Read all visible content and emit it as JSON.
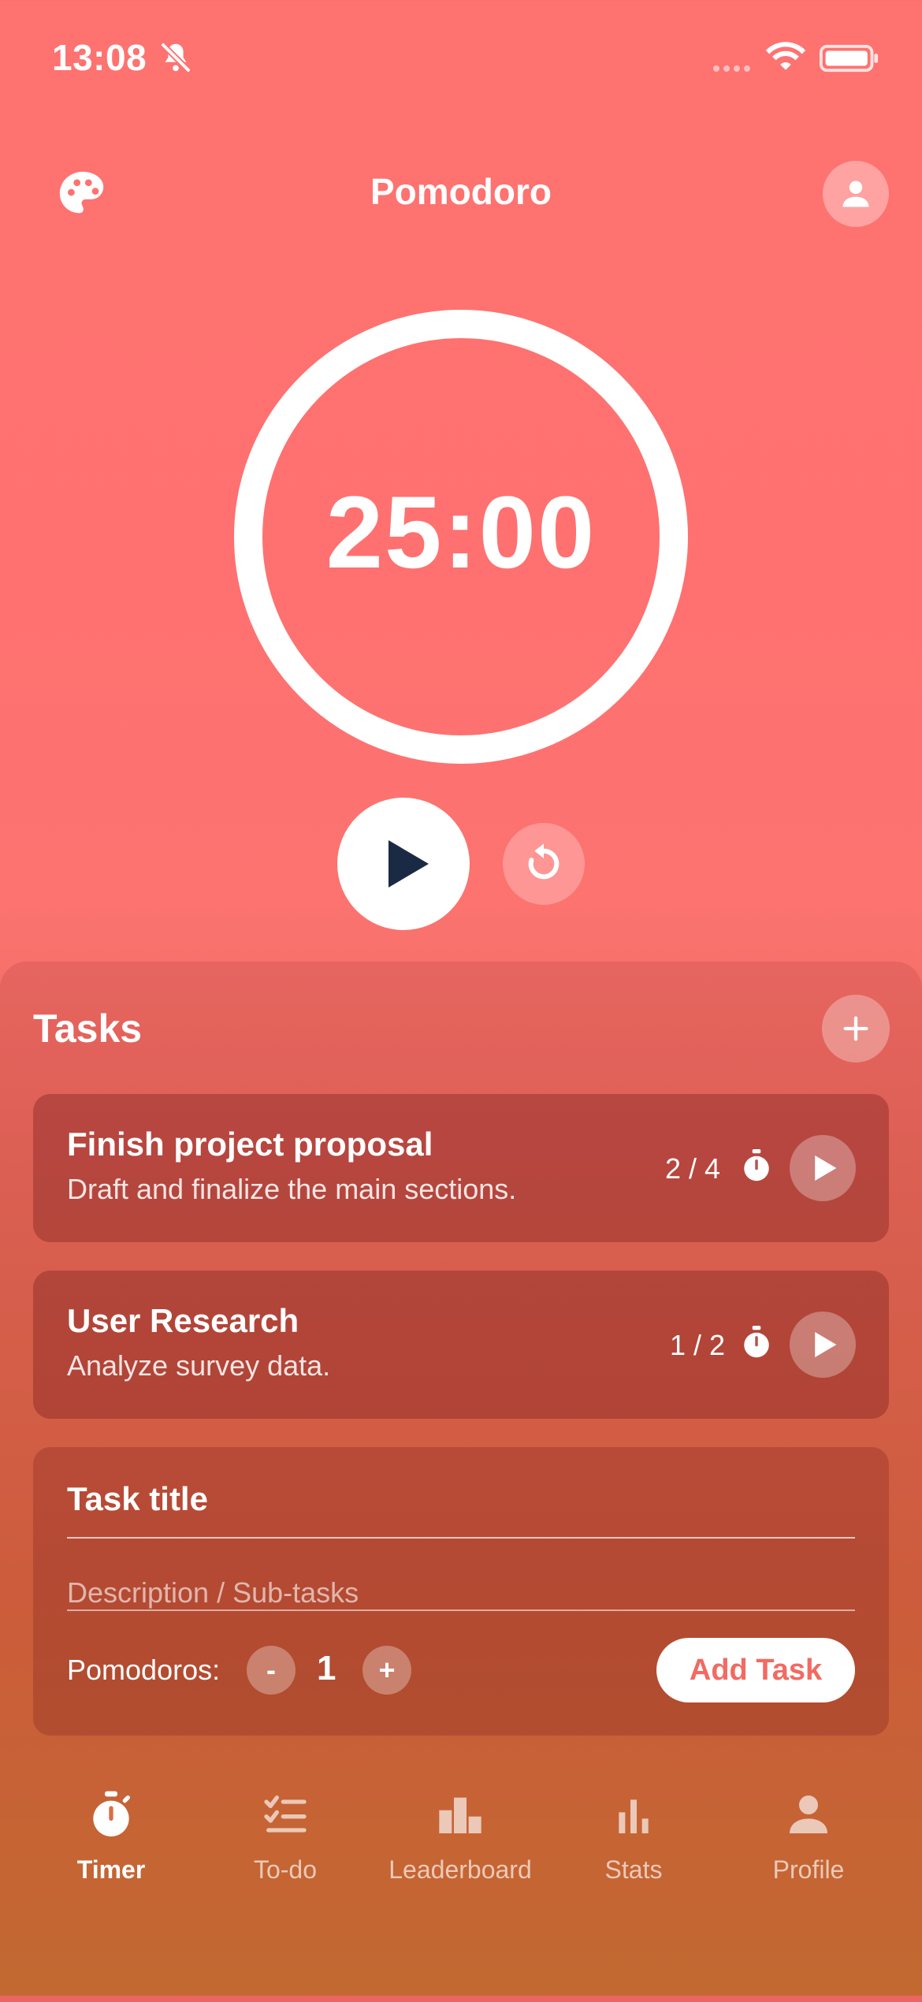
{
  "status": {
    "time": "13:08"
  },
  "header": {
    "title": "Pomodoro"
  },
  "timer": {
    "display": "25:00"
  },
  "tasks": {
    "heading": "Tasks",
    "items": [
      {
        "title": "Finish project proposal",
        "description": "Draft and finalize the main sections.",
        "count": "2 / 4"
      },
      {
        "title": "User Research",
        "description": "Analyze survey data.",
        "count": "1 / 2"
      }
    ]
  },
  "form": {
    "title_placeholder": "Task title",
    "desc_placeholder": "Description / Sub-tasks",
    "pomodoros_label": "Pomodoros:",
    "minus_label": "-",
    "plus_label": "+",
    "pomodoros_value": "1",
    "add_button": "Add Task"
  },
  "nav": {
    "items": [
      {
        "label": "Timer",
        "icon": "stopwatch-icon",
        "active": true
      },
      {
        "label": "To-do",
        "icon": "checklist-icon"
      },
      {
        "label": "Leaderboard",
        "icon": "leaderboard-icon"
      },
      {
        "label": "Stats",
        "icon": "stats-icon"
      },
      {
        "label": "Profile",
        "icon": "person-icon"
      }
    ]
  },
  "colors": {
    "accent": "#FE7270",
    "play_icon": "#1B2A44",
    "add_button_text": "#F26A62"
  }
}
